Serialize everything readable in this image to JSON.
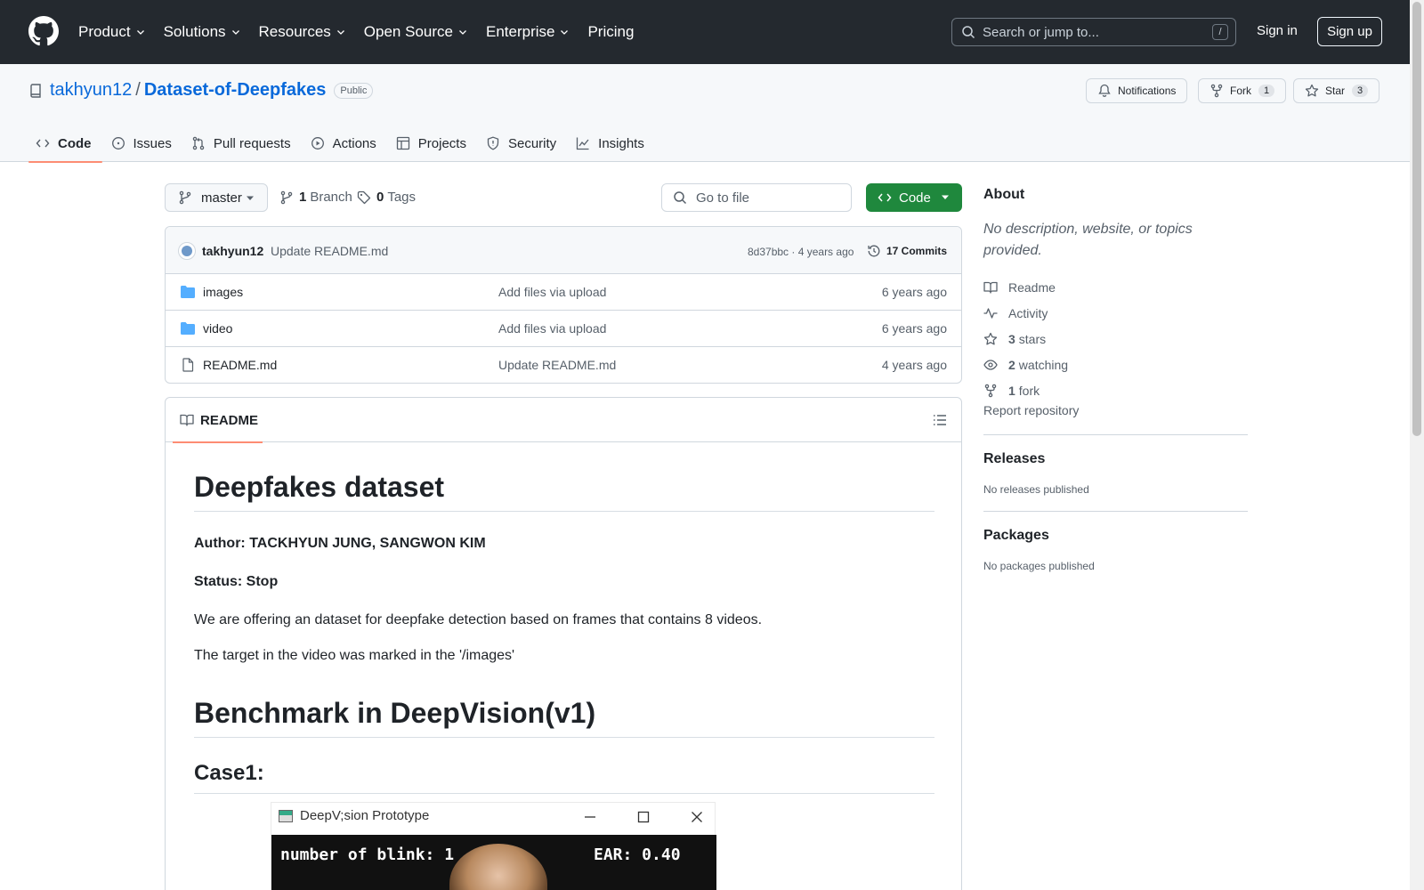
{
  "header": {
    "nav": [
      "Product",
      "Solutions",
      "Resources",
      "Open Source",
      "Enterprise",
      "Pricing"
    ],
    "search_placeholder": "Search or jump to...",
    "search_key": "/",
    "sign_in": "Sign in",
    "sign_up": "Sign up"
  },
  "repo": {
    "owner": "takhyun12",
    "separator": "/",
    "name": "Dataset-of-Deepfakes",
    "visibility": "Public",
    "notifications": "Notifications",
    "fork_label": "Fork",
    "fork_count": "1",
    "star_label": "Star",
    "star_count": "3",
    "tabs": [
      "Code",
      "Issues",
      "Pull requests",
      "Actions",
      "Projects",
      "Security",
      "Insights"
    ]
  },
  "toolbar": {
    "branch": "master",
    "branch_count": "1",
    "branch_label": "Branch",
    "tag_count": "0",
    "tag_label": "Tags",
    "goto_placeholder": "Go to file",
    "code_button": "Code"
  },
  "commit": {
    "author": "takhyun12",
    "message": "Update README.md",
    "sha_time": "8d37bbc · 4 years ago",
    "commits": "17 Commits"
  },
  "files": [
    {
      "name": "images",
      "type": "folder",
      "message": "Add files via upload",
      "date": "6 years ago"
    },
    {
      "name": "video",
      "type": "folder",
      "message": "Add files via upload",
      "date": "6 years ago"
    },
    {
      "name": "README.md",
      "type": "file",
      "message": "Update README.md",
      "date": "4 years ago"
    }
  ],
  "readme": {
    "tab": "README",
    "title": "Deepfakes dataset",
    "author": "Author: TACKHYUN JUNG, SANGWON KIM",
    "status": "Status: Stop",
    "p1": "We are offering an dataset for deepfake detection based on frames that contains 8 videos.",
    "p2": "The target in the video was marked in the '/images'",
    "h_benchmark": "Benchmark in DeepVision(v1)",
    "h_case1": "Case1:",
    "demo_title": "DeepV;sion Prototype",
    "demo_blink": "number of blink: 1",
    "demo_ear": "EAR: 0.40"
  },
  "about": {
    "heading": "About",
    "description": "No description, website, or topics provided.",
    "readme": "Readme",
    "activity": "Activity",
    "stars_count": "3",
    "stars_label": "stars",
    "watching_count": "2",
    "watching_label": "watching",
    "fork_count": "1",
    "fork_label": "fork",
    "report": "Report repository"
  },
  "releases": {
    "heading": "Releases",
    "empty": "No releases published"
  },
  "packages": {
    "heading": "Packages",
    "empty": "No packages published"
  }
}
